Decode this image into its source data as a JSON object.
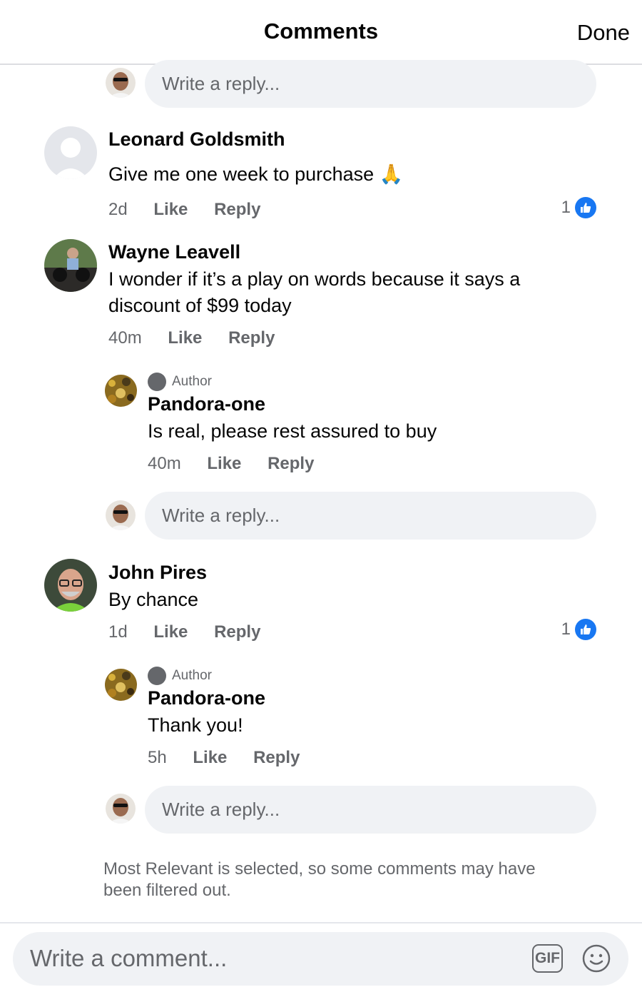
{
  "header": {
    "title": "Comments",
    "done_label": "Done"
  },
  "reply_placeholder": "Write a reply...",
  "comments": [
    {
      "author": "Leonard Goldsmith",
      "text": "Give me  one  week to purchase 🙏",
      "time": "2d",
      "like_label": "Like",
      "reply_label": "Reply",
      "like_count": "1"
    },
    {
      "author": "Wayne Leavell",
      "text": "I wonder if it’s a play on words because it says a discount of $99 today",
      "time": "40m",
      "like_label": "Like",
      "reply_label": "Reply",
      "reply": {
        "badge": "Author",
        "author": "Pandora-one",
        "text": "Is real, please rest assured to buy",
        "time": "40m",
        "like_label": "Like",
        "reply_label": "Reply"
      }
    },
    {
      "author": "John Pires",
      "text": "By chance",
      "time": "1d",
      "like_label": "Like",
      "reply_label": "Reply",
      "like_count": "1",
      "reply": {
        "badge": "Author",
        "author": "Pandora-one",
        "text": "Thank you!",
        "time": "5h",
        "like_label": "Like",
        "reply_label": "Reply"
      }
    }
  ],
  "filter_note": "Most Relevant is selected, so some comments may have been filtered out.",
  "composer": {
    "placeholder": "Write a comment...",
    "gif_label": "GIF"
  },
  "colors": {
    "like_blue": "#1877f2",
    "secondary_text": "#65676b",
    "input_bg": "#f0f2f5"
  },
  "icons": [
    "like-thumb-icon",
    "emoji-icon",
    "gif-icon",
    "author-badge-icon"
  ]
}
